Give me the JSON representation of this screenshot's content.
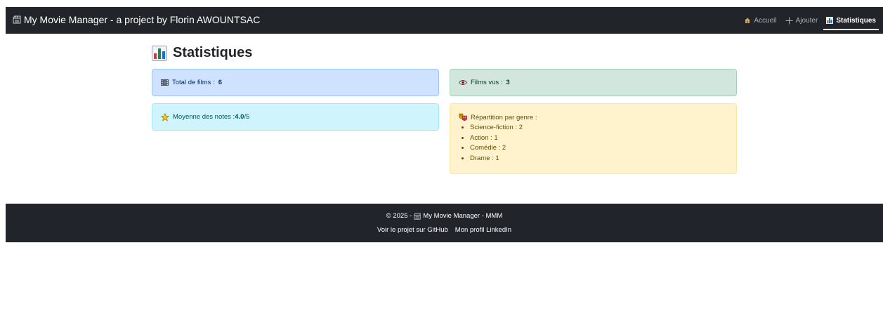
{
  "navbar": {
    "brand": "My Movie Manager - a project by Florin AWOUNTSAC",
    "links": [
      {
        "label": "Accueil",
        "icon": "house-icon"
      },
      {
        "label": "Ajouter",
        "icon": "plus-icon"
      },
      {
        "label": "Statistiques",
        "icon": "bar-chart-icon",
        "active": true
      }
    ]
  },
  "page": {
    "title": "Statistiques"
  },
  "stats": {
    "total_label": "Total de films : ",
    "total_value": "6",
    "seen_label": "Films vus : ",
    "seen_value": "3",
    "avg_label": "Moyenne des notes : ",
    "avg_value": "4.0",
    "avg_suffix": "/5",
    "genre_label": "Répartition par genre :",
    "genres": [
      "Science-fiction : 2",
      "Action : 1",
      "Comédie : 2",
      "Drame : 1"
    ]
  },
  "footer": {
    "copyright_prefix": "© 2025 - ",
    "copyright_name": "My Movie Manager - MMM",
    "github_link": "Voir le projet sur GitHub",
    "linkedin_link": "Mon profil LinkedIn"
  },
  "colors": {
    "navbar_bg": "#212529",
    "info_blue": "#cfe2ff",
    "info_green": "#d1e7dd",
    "info_cyan": "#cff4fc",
    "info_yellow": "#fff3cd"
  }
}
